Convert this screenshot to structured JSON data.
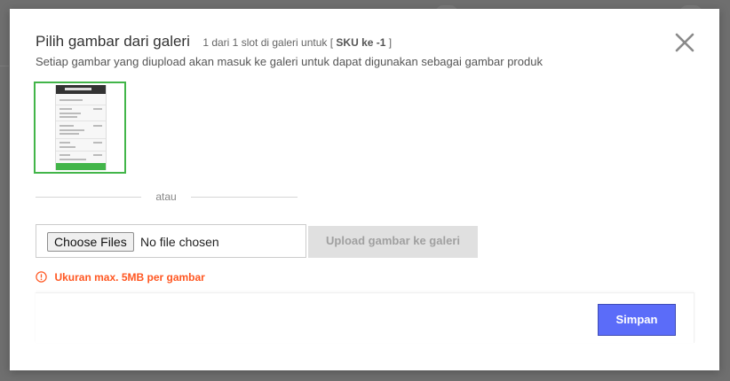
{
  "dialog": {
    "title": "Pilih gambar dari galeri",
    "slot_prefix": "1 dari 1 slot di galeri untuk [",
    "slot_sku": "SKU ke -1",
    "slot_suffix": "]",
    "subtitle": "Setiap gambar yang diupload akan masuk ke galeri untuk dapat digunakan sebagai gambar produk",
    "close_icon": "close-icon"
  },
  "gallery": {
    "selected_border_color": "#42b549",
    "images": [
      {
        "selected": true,
        "thumb_header": "Booking Confirmation"
      }
    ]
  },
  "divider": {
    "text": "atau"
  },
  "upload": {
    "choose_label": "Choose Files",
    "no_file_label": "No file chosen",
    "upload_label": "Upload gambar ke galeri"
  },
  "warning": {
    "icon": "info-circle-icon",
    "text": "Ukuran max. 5MB per gambar",
    "color": "#ff5722"
  },
  "footer": {
    "save_label": "Simpan",
    "save_color": "#5b6cf9"
  }
}
